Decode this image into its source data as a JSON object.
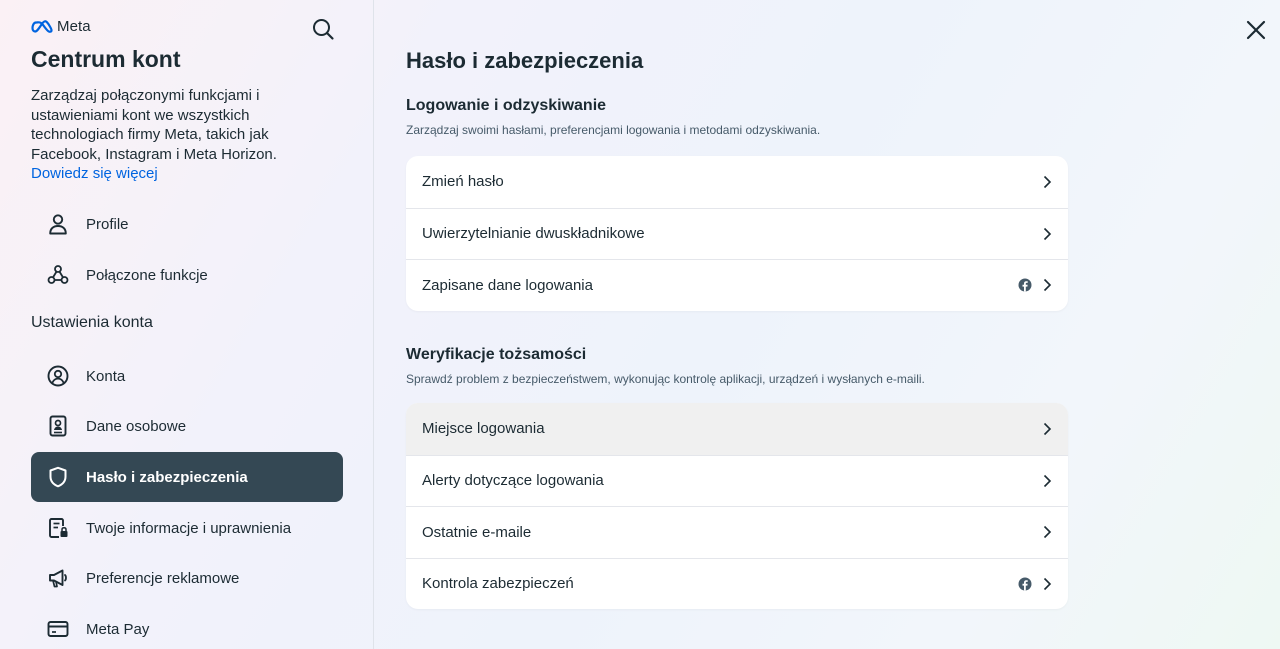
{
  "brand": {
    "logo_text": "Meta"
  },
  "sidebar": {
    "title": "Centrum kont",
    "description": "Zarządzaj połączonymi funkcjami i ustawieniami kont we wszystkich technologiach firmy Meta, takich jak Facebook, Instagram i Meta Horizon.",
    "learn_more": "Dowiedz się więcej",
    "top_items": [
      {
        "label": "Profile",
        "icon": "user-icon"
      },
      {
        "label": "Połączone funkcje",
        "icon": "connected-nodes-icon"
      }
    ],
    "section_label": "Ustawienia konta",
    "items": [
      {
        "label": "Konta",
        "icon": "account-circle-icon"
      },
      {
        "label": "Dane osobowe",
        "icon": "id-card-icon"
      },
      {
        "label": "Hasło i zabezpieczenia",
        "icon": "shield-icon",
        "active": true
      },
      {
        "label": "Twoje informacje i uprawnienia",
        "icon": "document-lock-icon"
      },
      {
        "label": "Preferencje reklamowe",
        "icon": "megaphone-icon"
      },
      {
        "label": "Meta Pay",
        "icon": "credit-card-icon"
      }
    ]
  },
  "main": {
    "title": "Hasło i zabezpieczenia",
    "sections": [
      {
        "heading": "Logowanie i odzyskiwanie",
        "description": "Zarządzaj swoimi hasłami, preferencjami logowania i metodami odzyskiwania.",
        "rows": [
          {
            "label": "Zmień hasło"
          },
          {
            "label": "Uwierzytelnianie dwuskładnikowe"
          },
          {
            "label": "Zapisane dane logowania",
            "facebook_badge": true
          }
        ]
      },
      {
        "heading": "Weryfikacje tożsamości",
        "description": "Sprawdź problem z bezpieczeństwem, wykonując kontrolę aplikacji, urządzeń i wysłanych e-maili.",
        "rows": [
          {
            "label": "Miejsce logowania",
            "hover": true
          },
          {
            "label": "Alerty dotyczące logowania"
          },
          {
            "label": "Ostatnie e-maile"
          },
          {
            "label": "Kontrola zabezpieczeń",
            "facebook_badge": true
          }
        ]
      }
    ]
  },
  "colors": {
    "text": "#1c2b33",
    "link": "#0064e0",
    "active_nav_bg": "#344854",
    "muted": "#465a69"
  }
}
